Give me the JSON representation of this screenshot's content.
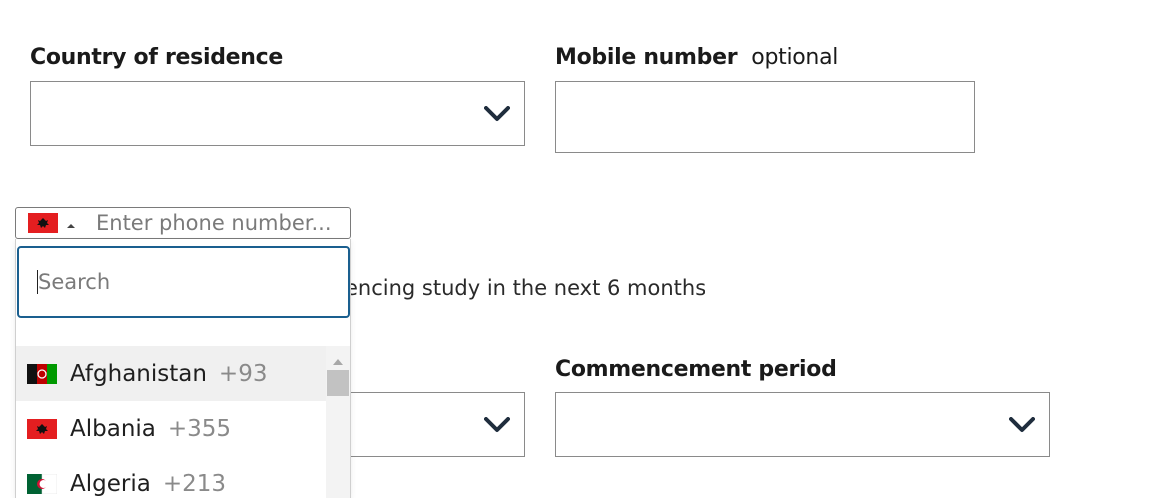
{
  "fields": {
    "country_of_residence": {
      "label": "Country of residence",
      "value": ""
    },
    "mobile_number": {
      "label": "Mobile number",
      "optional_text": "optional",
      "value": ""
    },
    "commencement_period": {
      "label": "Commencement period",
      "value": ""
    },
    "unlabeled_select": {
      "value": ""
    }
  },
  "phone": {
    "selected_country": "Albania",
    "placeholder": "Enter phone number..."
  },
  "background_text": "encing study in the next 6 months",
  "country_dropdown": {
    "search_placeholder": "Search",
    "countries": [
      {
        "name": "Afghanistan",
        "dial": "+93",
        "flag_icon": "afghanistan-flag-icon"
      },
      {
        "name": "Albania",
        "dial": "+355",
        "flag_icon": "albania-flag-icon"
      },
      {
        "name": "Algeria",
        "dial": "+213",
        "flag_icon": "algeria-flag-icon"
      }
    ]
  },
  "colors": {
    "focus_border": "#1a5f8f",
    "field_border": "#8a8a8a",
    "hover_row": "#f0f0f0",
    "dial_text": "#8a8a8a"
  }
}
